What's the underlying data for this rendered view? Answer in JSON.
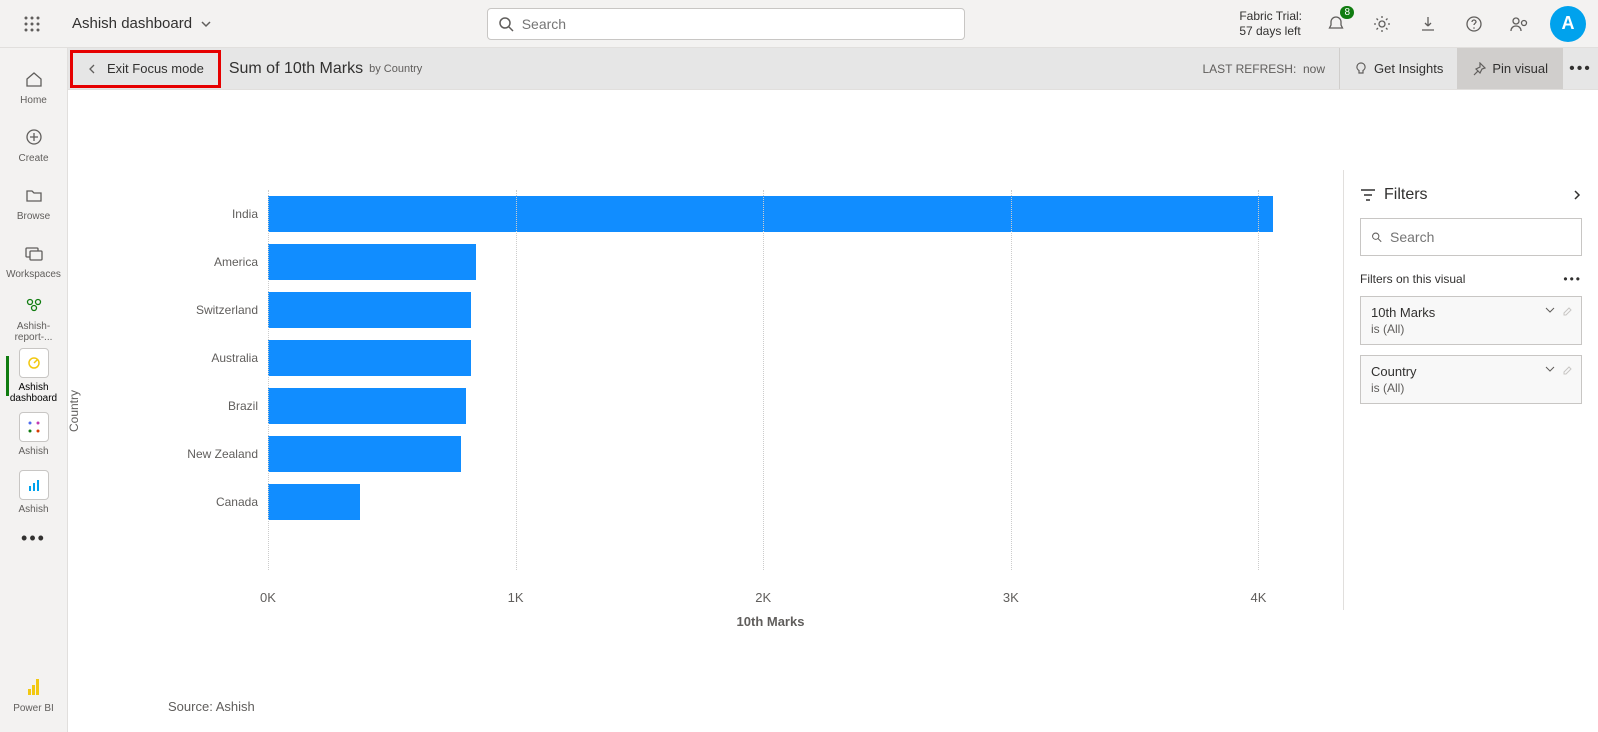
{
  "topbar": {
    "dashboard_name": "Ashish dashboard",
    "search_placeholder": "Search",
    "trial_line1": "Fabric Trial:",
    "trial_line2": "57 days left",
    "notification_count": "8",
    "avatar_initial": "A"
  },
  "leftnav": {
    "items": [
      {
        "label": "Home"
      },
      {
        "label": "Create"
      },
      {
        "label": "Browse"
      },
      {
        "label": "Workspaces"
      },
      {
        "label": "Ashish-report-..."
      },
      {
        "label": "Ashish dashboard"
      },
      {
        "label": "Ashish"
      },
      {
        "label": "Ashish"
      }
    ],
    "bottom_label": "Power BI"
  },
  "actionbar": {
    "exit_focus": "Exit Focus mode",
    "title": "Sum of 10th Marks",
    "subtitle": "by Country",
    "last_refresh_label": "LAST REFRESH:",
    "last_refresh_value": "now",
    "get_insights": "Get Insights",
    "pin_visual": "Pin visual"
  },
  "filters": {
    "title": "Filters",
    "search_placeholder": "Search",
    "section_title": "Filters on this visual",
    "card1_name": "10th Marks",
    "card1_value": "is (All)",
    "card2_name": "Country",
    "card2_value": "is (All)"
  },
  "chart_meta": {
    "ylabel": "Country",
    "xlabel": "10th Marks",
    "source": "Source: Ashish",
    "ticks": [
      "0K",
      "1K",
      "2K",
      "3K",
      "4K"
    ]
  },
  "chart_data": {
    "type": "bar",
    "title": "Sum of 10th Marks by Country",
    "xlabel": "10th Marks",
    "ylabel": "Country",
    "categories": [
      "India",
      "America",
      "Switzerland",
      "Australia",
      "Brazil",
      "New Zealand",
      "Canada"
    ],
    "values": [
      4100,
      840,
      820,
      820,
      800,
      780,
      370
    ],
    "xlim": [
      0,
      4200
    ],
    "x_ticks": [
      0,
      1000,
      2000,
      3000,
      4000
    ]
  }
}
